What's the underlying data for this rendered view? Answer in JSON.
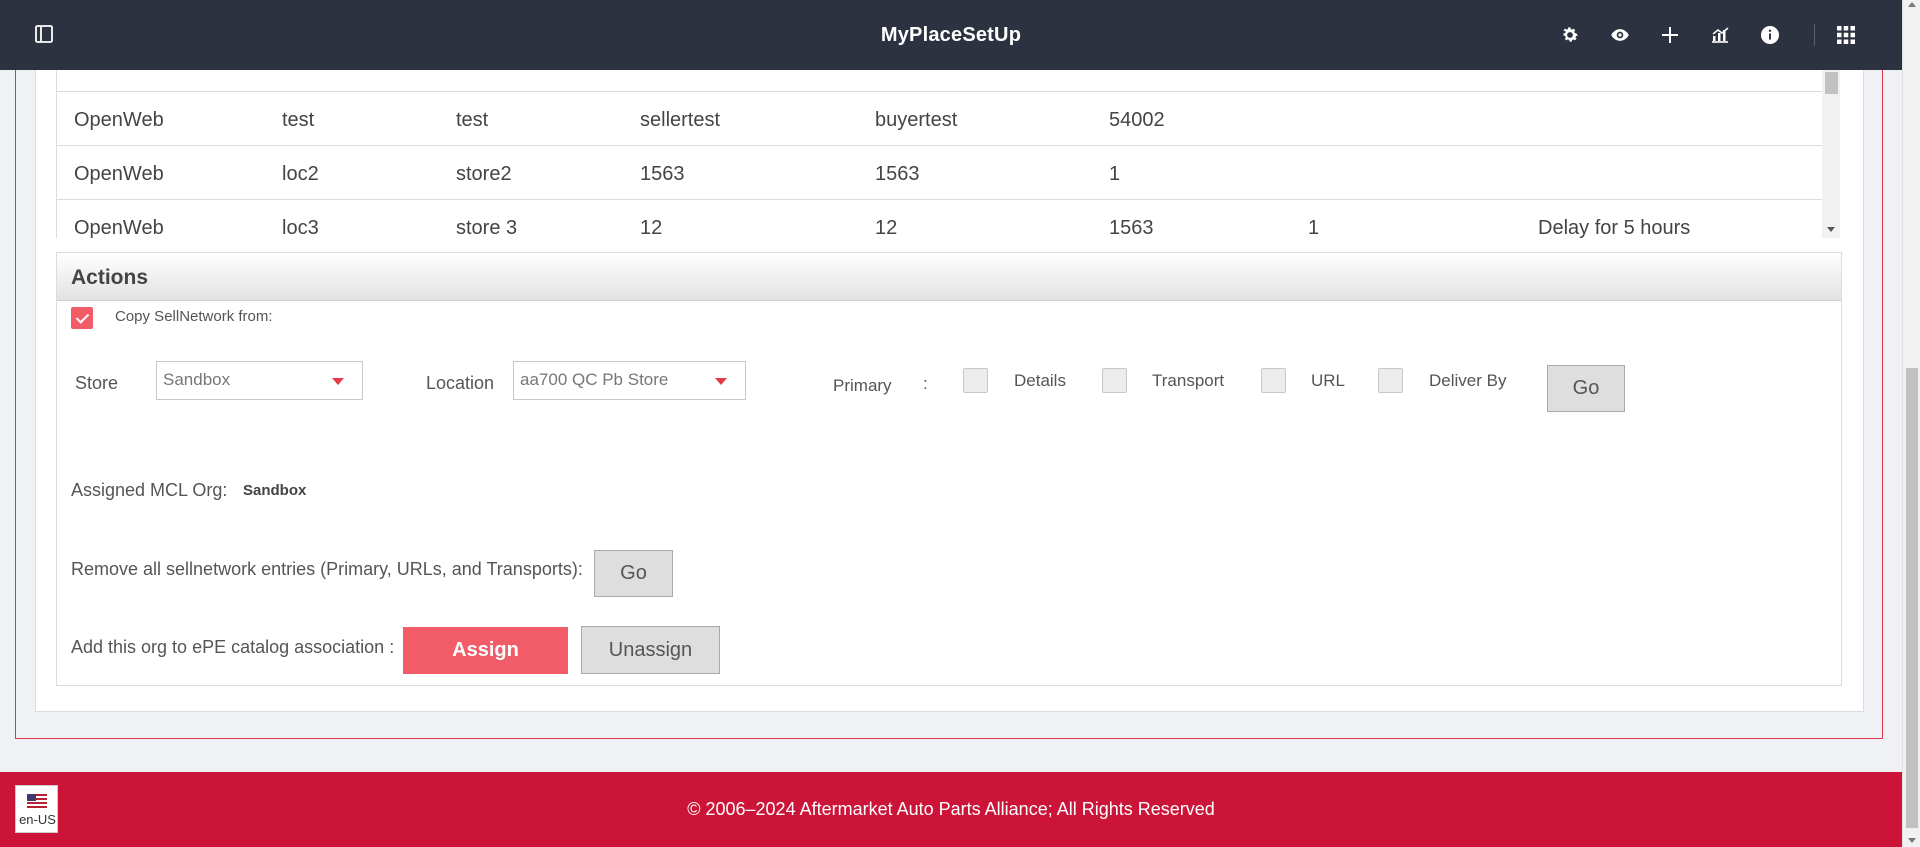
{
  "header": {
    "title": "MyPlaceSetUp",
    "icons": [
      "sidebar-toggle-icon",
      "gear-icon",
      "eye-icon",
      "plus-icon",
      "analytics-icon",
      "info-icon",
      "apps-grid-icon"
    ]
  },
  "table": {
    "rows": [
      [
        "OpenWeb",
        "test",
        "test",
        "sellertest",
        "buyertest",
        "54002",
        "",
        ""
      ],
      [
        "OpenWeb",
        "loc2",
        "store2",
        "1563",
        "1563",
        "1",
        "",
        ""
      ],
      [
        "OpenWeb",
        "loc3",
        "store 3",
        "12",
        "12",
        "1563",
        "1",
        "Delay for 5 hours"
      ]
    ]
  },
  "actions": {
    "title": "Actions",
    "copy_label": "Copy SellNetwork from:",
    "copy_checked": true,
    "store_label": "Store",
    "store_value": "Sandbox",
    "location_label": "Location",
    "location_value": "aa700 QC Pb Store",
    "primary_label": "Primary",
    "primary_colon": ":",
    "options": [
      "Details",
      "Transport",
      "URL",
      "Deliver By"
    ],
    "go_label": "Go",
    "assigned_label": "Assigned MCL Org:",
    "assigned_value": "Sandbox",
    "remove_label": "Remove all sellnetwork entries (Primary, URLs, and Transports):",
    "remove_go_label": "Go",
    "assoc_label": "Add this org to ePE catalog association :",
    "assign_label": "Assign",
    "unassign_label": "Unassign"
  },
  "footer": {
    "copyright": "© 2006–2024 Aftermarket Auto Parts Alliance; All Rights Reserved",
    "lang": "en-US"
  },
  "colors": {
    "header_bg": "#2d3240",
    "accent_red": "#f25c68",
    "footer_bg": "#cc1438"
  }
}
